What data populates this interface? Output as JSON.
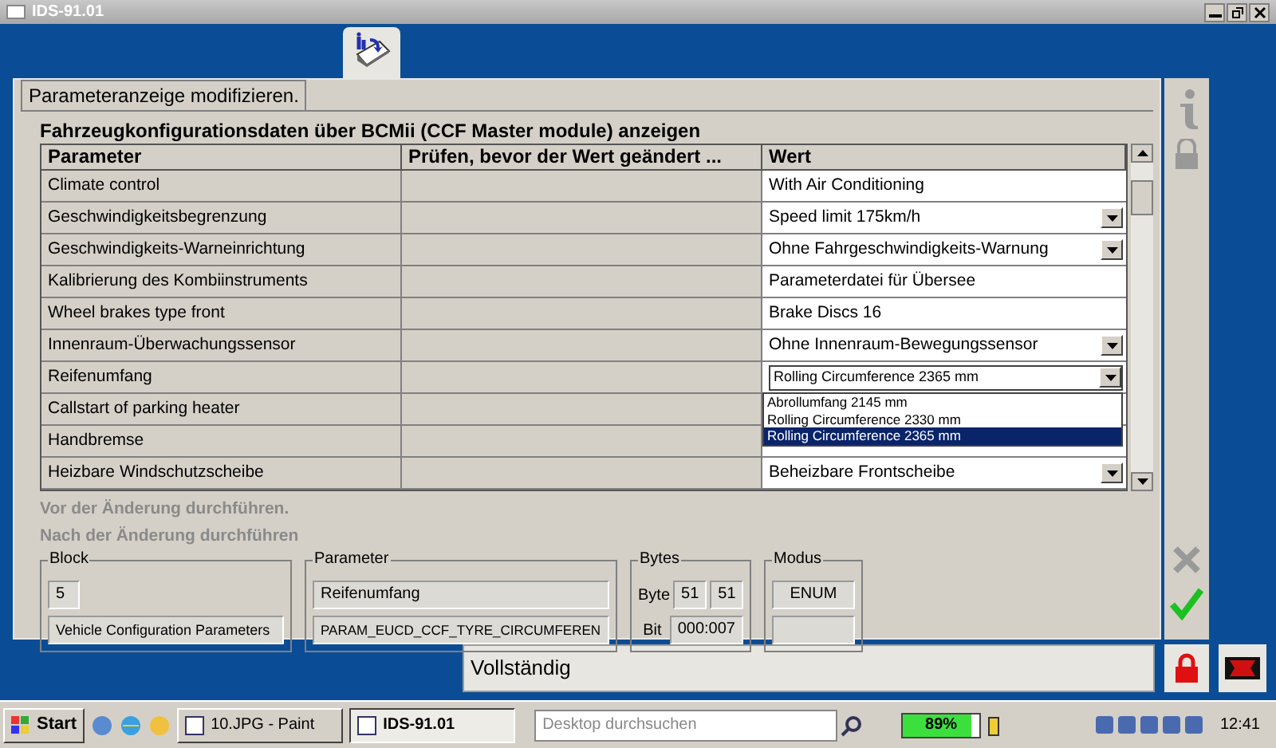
{
  "window": {
    "title": "IDS-91.01"
  },
  "tab": {
    "label": "Parameteranzeige modifizieren.",
    "selected": true
  },
  "subtitle": "Fahrzeugkonfigurationsdaten über BCMii (CCF Master module) anzeigen",
  "table": {
    "columns": [
      "Parameter",
      "Prüfen, bevor der Wert geändert ...",
      "Wert"
    ],
    "rows": [
      {
        "parameter": "Climate control",
        "value": "With Air Conditioning",
        "kind": "text"
      },
      {
        "parameter": "Geschwindigkeitsbegrenzung",
        "value": "Speed limit 175km/h",
        "kind": "dropdown"
      },
      {
        "parameter": "Geschwindigkeits-Warneinrichtung",
        "value": "Ohne Fahrgeschwindigkeits-Warnung",
        "kind": "dropdown"
      },
      {
        "parameter": "Kalibrierung des Kombiinstruments",
        "value": "Parameterdatei für Übersee",
        "kind": "text"
      },
      {
        "parameter": "Wheel brakes type front",
        "value": "Brake Discs 16",
        "kind": "text"
      },
      {
        "parameter": "Innenraum-Überwachungssensor",
        "value": "Ohne Innenraum-Bewegungssensor",
        "kind": "dropdown"
      },
      {
        "parameter": "Reifenumfang",
        "value": "Rolling Circumference 2365 mm",
        "kind": "open",
        "options": [
          {
            "label": "Abrollumfang 2145 mm",
            "selected": false
          },
          {
            "label": "Rolling Circumference 2330 mm",
            "selected": false
          },
          {
            "label": "Rolling Circumference 2365 mm",
            "selected": true
          }
        ]
      },
      {
        "parameter": "Callstart of parking heater",
        "kind": "text"
      },
      {
        "parameter": "Handbremse",
        "kind": "text"
      },
      {
        "parameter": "Heizbare Windschutzscheibe",
        "value": "Beheizbare Frontscheibe",
        "kind": "dropdown"
      }
    ]
  },
  "steps": [
    "Vor der Änderung durchführen.",
    "Nach der Änderung durchführen"
  ],
  "block": {
    "legend": "Block",
    "number": "5",
    "name": "Vehicle Configuration Parameters"
  },
  "parameter": {
    "legend": "Parameter",
    "name": "Reifenumfang",
    "id": "PARAM_EUCD_CCF_TYRE_CIRCUMFEREN"
  },
  "bytes": {
    "legend": "Bytes",
    "byte_label": "Byte",
    "byte_from": "51",
    "byte_to": "51",
    "bit_label": "Bit",
    "bit": "000:007"
  },
  "modus": {
    "legend": "Modus",
    "value": "ENUM"
  },
  "status": "Vollständig",
  "taskbar": {
    "start": "Start",
    "tasks": [
      {
        "label": "10.JPG - Paint",
        "selected": false
      },
      {
        "label": "IDS-91.01",
        "selected": true
      }
    ],
    "search_placeholder": "Desktop durchsuchen",
    "battery": {
      "reading": "89%",
      "level": 0.89
    },
    "clock": "12:41"
  }
}
